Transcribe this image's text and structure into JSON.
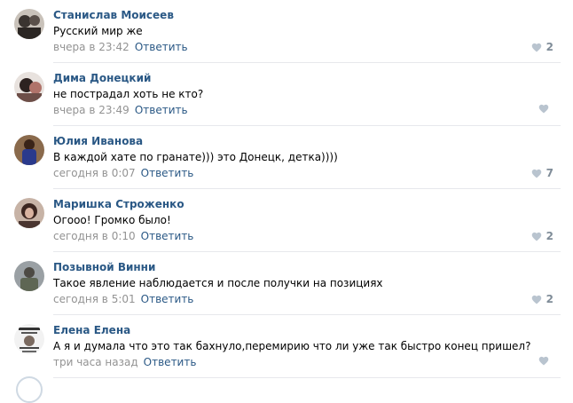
{
  "comments": [
    {
      "author": "Станислав Моисеев",
      "text": "Русский мир же",
      "date": "вчера в 23:42",
      "reply": "Ответить",
      "likes": "2",
      "avatar_color": "#6b6460"
    },
    {
      "author": "Дима Донецкий",
      "text": "не пострадал хоть не кто?",
      "date": "вчера в 23:49",
      "reply": "Ответить",
      "likes": "",
      "avatar_color": "#7a5a52"
    },
    {
      "author": "Юлия Иванова",
      "text": "В каждой хате по гранате))) это Донецк, детка))))",
      "date": "сегодня в 0:07",
      "reply": "Ответить",
      "likes": "7",
      "avatar_color": "#3b4a7a"
    },
    {
      "author": "Маришка Строженко",
      "text": "Огооо! Громко было!",
      "date": "сегодня в 0:10",
      "reply": "Ответить",
      "likes": "2",
      "avatar_color": "#5a4038"
    },
    {
      "author": "Позывной Винни",
      "text": "Такое явление наблюдается и после получки на позициях",
      "date": "сегодня в 5:01",
      "reply": "Ответить",
      "likes": "2",
      "avatar_color": "#6f7266"
    },
    {
      "author": "Елена Елена",
      "text": "А я и думала что это так бахнуло,перемирию что ли уже так быстро конец пришел?",
      "date": "три часа назад",
      "reply": "Ответить",
      "likes": "",
      "avatar_color": "#d8d8d8"
    }
  ],
  "icons": {
    "like": "heart-icon"
  },
  "colors": {
    "link": "#2a5885",
    "meta": "#939393",
    "like": "#b9c4cf",
    "divider": "#e7e8ec"
  }
}
